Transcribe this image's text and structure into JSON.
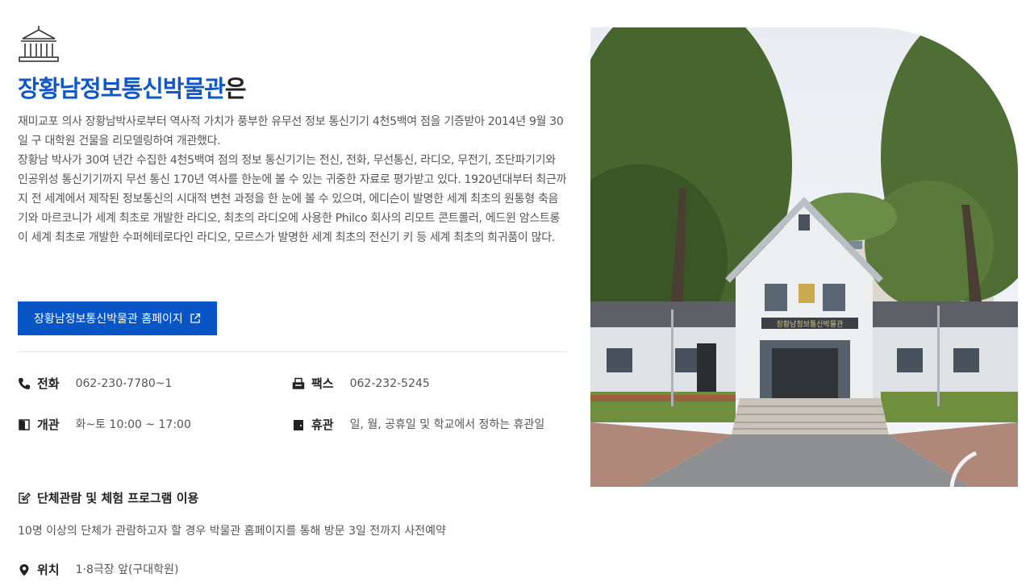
{
  "museum": {
    "title_accent": "장황남정보통신박물관",
    "title_suffix": "은",
    "description": "재미교포 의사 장황남박사로부터 역사적 가치가 풍부한 유무선 정보 통신기기 4천5백여 점을 기증받아 2014년 9월 30일 구 대학원 건물을 리모델링하여 개관했다.\n장황남 박사가 30여 년간 수집한 4천5백여 점의 정보 통신기기는 전신, 전화, 무선통신, 라디오, 무전기, 조단파기기와 인공위성 통신기기까지 무선 통신 170년 역사를 한눈에 볼 수 있는 귀중한 자료로 평가받고 있다. 1920년대부터 최근까지 전 세계에서 제작된 정보통신의 시대적 변천 과정을 한 눈에 볼 수 있으며, 에디슨이 발명한 세계 최초의 원통형 축음기와 마르코니가 세계 최초로 개발한 라디오, 최초의 라디오에 사용한 Philco 회사의 리모트 콘트롤러, 에드윈 암스트롱이 세계 최초로 개발한 수퍼헤테로다인 라디오, 모르스가 발명한 세계 최초의 전신기 키 등 세계 최초의 희귀품이 많다.",
    "homepage_button": "장황남정보통신박물관 홈페이지",
    "phone_label": "전화",
    "phone_value": "062-230-7780~1",
    "fax_label": "팩스",
    "fax_value": "062-232-5245",
    "hours_label": "개관",
    "hours_value": "화~토 10:00 ~ 17:00",
    "closed_label": "휴관",
    "closed_value": "일, 월, 공휴일 및 학교에서 정하는 휴관일",
    "group_title": "단체관람 및 체험 프로그램 이용",
    "group_desc": "10명 이상의 단체가 관람하고자 할 경우 박물관 홈페이지를 통해 방문 3일 전까지 사전예약",
    "location_label": "위치",
    "location_value": "1·8극장 앞(구대학원)",
    "building_sign": "장황남정보통신박물관"
  },
  "icons": {
    "museum": "museum-icon",
    "external_link": "external-link-icon",
    "phone": "phone-icon",
    "fax": "fax-icon",
    "hours": "door-open-icon",
    "closed": "door-closed-icon",
    "group": "edit-note-icon",
    "location": "map-pin-icon"
  },
  "colors": {
    "accent": "#1158c7",
    "button": "#0a55c6"
  }
}
